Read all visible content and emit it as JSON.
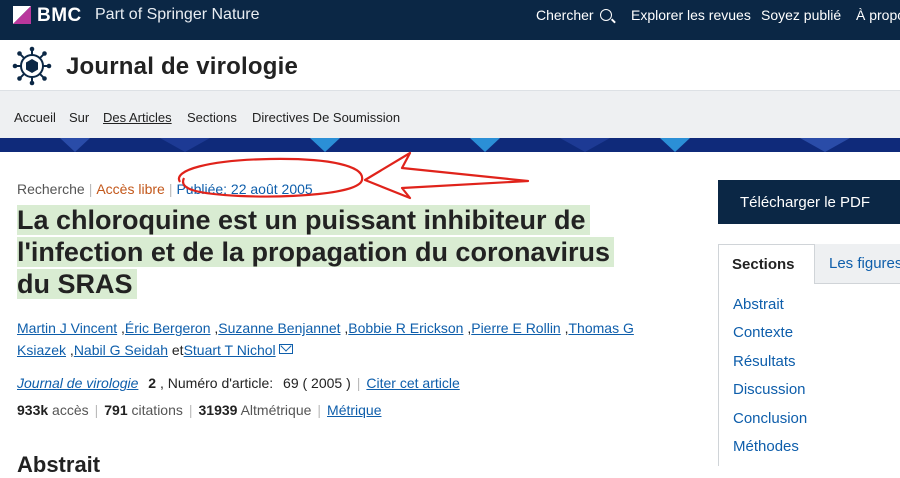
{
  "topbar": {
    "brand": "BMC",
    "brand_sub": "Part of Springer Nature",
    "search_label": "Chercher",
    "explore_label": "Explorer les revues",
    "publish_label": "Soyez publié",
    "about_label": "À propos"
  },
  "journal": {
    "title": "Journal de virologie"
  },
  "nav": {
    "home": "Accueil",
    "about": "Sur",
    "articles": "Des Articles",
    "sections": "Sections",
    "guidelines": "Directives De Soumission"
  },
  "article": {
    "type": "Recherche",
    "access": "Accès libre",
    "published": "Publiée: 22 août 2005",
    "title": "La chloroquine est un puissant inhibiteur de l'infection et de la propagation du coronavirus du SRAS",
    "authors": [
      "Martin J Vincent",
      "Éric Bergeron",
      "Suzanne Benjannet",
      "Bobbie R Erickson",
      "Pierre E Rollin",
      "Thomas G Ksiazek",
      "Nabil G Seidah"
    ],
    "author_connector": "et",
    "last_author": "Stuart T Nichol",
    "journal_name": "Journal de virologie",
    "volume": "2",
    "article_number_label": ", Numéro d'article:",
    "article_number": "69",
    "year": "( 2005 )",
    "cite_label": "Citer cet article",
    "accesses_value": "933k",
    "accesses_label": "accès",
    "citations_value": "791",
    "citations_label": "citations",
    "altmetric_value": "31939",
    "altmetric_label": "Altmétrique",
    "metrics_label": "Métrique",
    "next_heading": "Abstrait"
  },
  "sidebar": {
    "pdf_label": "Télécharger le PDF",
    "tab_sections": "Sections",
    "tab_figures": "Les figures",
    "sections": [
      "Abstrait",
      "Contexte",
      "Résultats",
      "Discussion",
      "Conclusion",
      "Méthodes"
    ]
  },
  "colors": {
    "topbar": "#0b2745",
    "link": "#0e5eab",
    "open_access": "#c3581b",
    "title_highlight": "#d9ecd2",
    "annotation": "#e0231b"
  }
}
